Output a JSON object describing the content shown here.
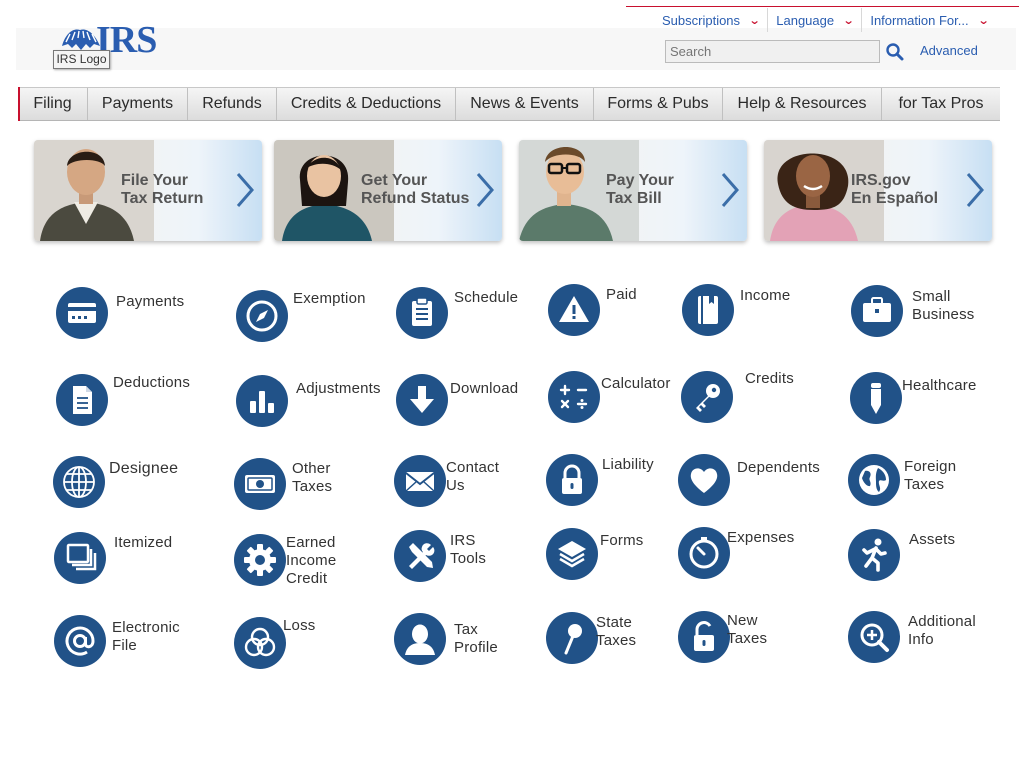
{
  "header": {
    "logo_text": "IRS",
    "logo_tooltip": "IRS Logo",
    "top_links": [
      {
        "label": "Subscriptions"
      },
      {
        "label": "Language"
      },
      {
        "label": "Information For..."
      }
    ],
    "search": {
      "placeholder": "Search",
      "value": "Search"
    },
    "advanced_label": "Advanced",
    "colors": {
      "link": "#2a5db0",
      "accent": "#c8102e"
    }
  },
  "nav": {
    "items": [
      "Filing",
      "Payments",
      "Refunds",
      "Credits & Deductions",
      "News & Events",
      "Forms & Pubs",
      "Help & Resources",
      "for Tax Pros"
    ]
  },
  "banners": [
    {
      "text": "File Your\nTax Return"
    },
    {
      "text": "Get Your\nRefund Status"
    },
    {
      "text": "Pay Your\nTax Bill"
    },
    {
      "text": "IRS.gov\nEn Español"
    }
  ],
  "icon_color": "#215288",
  "tiles": [
    {
      "label": "Payments",
      "icon": "credit-card-icon"
    },
    {
      "label": "Exemption",
      "icon": "compass-icon"
    },
    {
      "label": "Schedule",
      "icon": "clipboard-icon"
    },
    {
      "label": "Paid",
      "icon": "warning-icon"
    },
    {
      "label": "Income",
      "icon": "book-icon"
    },
    {
      "label": "Small\nBusiness",
      "icon": "briefcase-icon"
    },
    {
      "label": "Deductions",
      "icon": "document-icon"
    },
    {
      "label": "Adjustments",
      "icon": "bar-chart-icon"
    },
    {
      "label": "Download",
      "icon": "download-icon"
    },
    {
      "label": "Calculator",
      "icon": "calculator-icon"
    },
    {
      "label": "Credits",
      "icon": "key-icon"
    },
    {
      "label": "Healthcare",
      "icon": "pen-icon"
    },
    {
      "label": "Designee",
      "icon": "globe-grid-icon"
    },
    {
      "label": "Other Taxes",
      "icon": "money-icon"
    },
    {
      "label": "Contact Us",
      "icon": "envelope-icon"
    },
    {
      "label": "Liability",
      "icon": "lock-icon"
    },
    {
      "label": "Dependents",
      "icon": "heart-icon"
    },
    {
      "label": "Foreign Taxes",
      "icon": "earth-icon"
    },
    {
      "label": "Itemized",
      "icon": "stacked-windows-icon"
    },
    {
      "label": "Earned\nIncome Credit",
      "icon": "gear-icon"
    },
    {
      "label": "IRS Tools",
      "icon": "tools-icon"
    },
    {
      "label": "Forms",
      "icon": "layers-icon"
    },
    {
      "label": "Expenses",
      "icon": "stopwatch-icon"
    },
    {
      "label": "Assets",
      "icon": "runner-icon"
    },
    {
      "label": "Electronic File",
      "icon": "at-sign-icon"
    },
    {
      "label": "Loss",
      "icon": "rings-icon"
    },
    {
      "label": "Tax Profile",
      "icon": "user-icon"
    },
    {
      "label": "State\nTaxes",
      "icon": "pin-icon"
    },
    {
      "label": "New Taxes",
      "icon": "unlock-icon"
    },
    {
      "label": "Additional Info",
      "icon": "zoom-in-icon"
    }
  ]
}
